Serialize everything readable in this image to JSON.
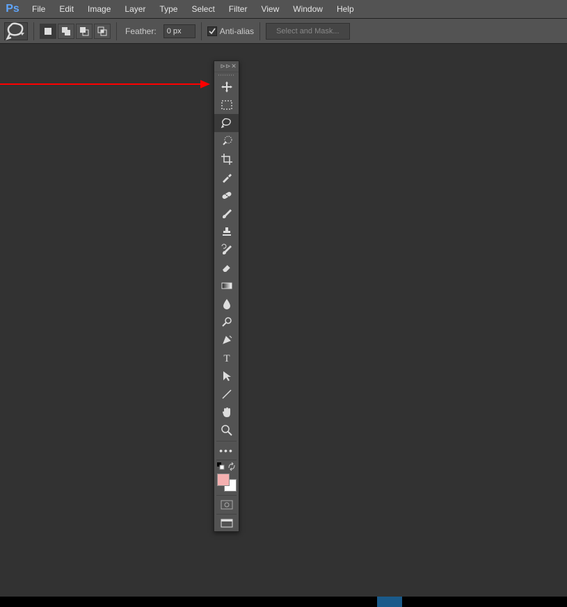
{
  "app": {
    "name": "Ps"
  },
  "menu": [
    "File",
    "Edit",
    "Image",
    "Layer",
    "Type",
    "Select",
    "Filter",
    "View",
    "Window",
    "Help"
  ],
  "options": {
    "feather_label": "Feather:",
    "feather_value": "0 px",
    "antialias_label": "Anti-alias",
    "antialias_checked": true,
    "select_mask_label": "Select and Mask..."
  },
  "tools": [
    {
      "id": "move",
      "name": "move-tool"
    },
    {
      "id": "marquee",
      "name": "rectangular-marquee-tool"
    },
    {
      "id": "lasso",
      "name": "lasso-tool",
      "active": true
    },
    {
      "id": "quick-select",
      "name": "quick-selection-tool"
    },
    {
      "id": "crop",
      "name": "crop-tool"
    },
    {
      "id": "eyedropper",
      "name": "eyedropper-tool"
    },
    {
      "id": "heal",
      "name": "spot-healing-brush-tool"
    },
    {
      "id": "brush",
      "name": "brush-tool"
    },
    {
      "id": "stamp",
      "name": "clone-stamp-tool"
    },
    {
      "id": "history-brush",
      "name": "history-brush-tool"
    },
    {
      "id": "eraser",
      "name": "eraser-tool"
    },
    {
      "id": "gradient",
      "name": "gradient-tool"
    },
    {
      "id": "blur",
      "name": "blur-tool"
    },
    {
      "id": "dodge",
      "name": "dodge-tool"
    },
    {
      "id": "pen",
      "name": "pen-tool"
    },
    {
      "id": "type",
      "name": "type-tool"
    },
    {
      "id": "path-select",
      "name": "path-selection-tool"
    },
    {
      "id": "line",
      "name": "line-tool"
    },
    {
      "id": "hand",
      "name": "hand-tool"
    },
    {
      "id": "zoom",
      "name": "zoom-tool"
    }
  ],
  "colors": {
    "foreground": "#f4b0b0",
    "background": "#ffffff"
  },
  "selection_modes": [
    "new",
    "add",
    "subtract",
    "intersect"
  ],
  "selection_mode_active": "new"
}
